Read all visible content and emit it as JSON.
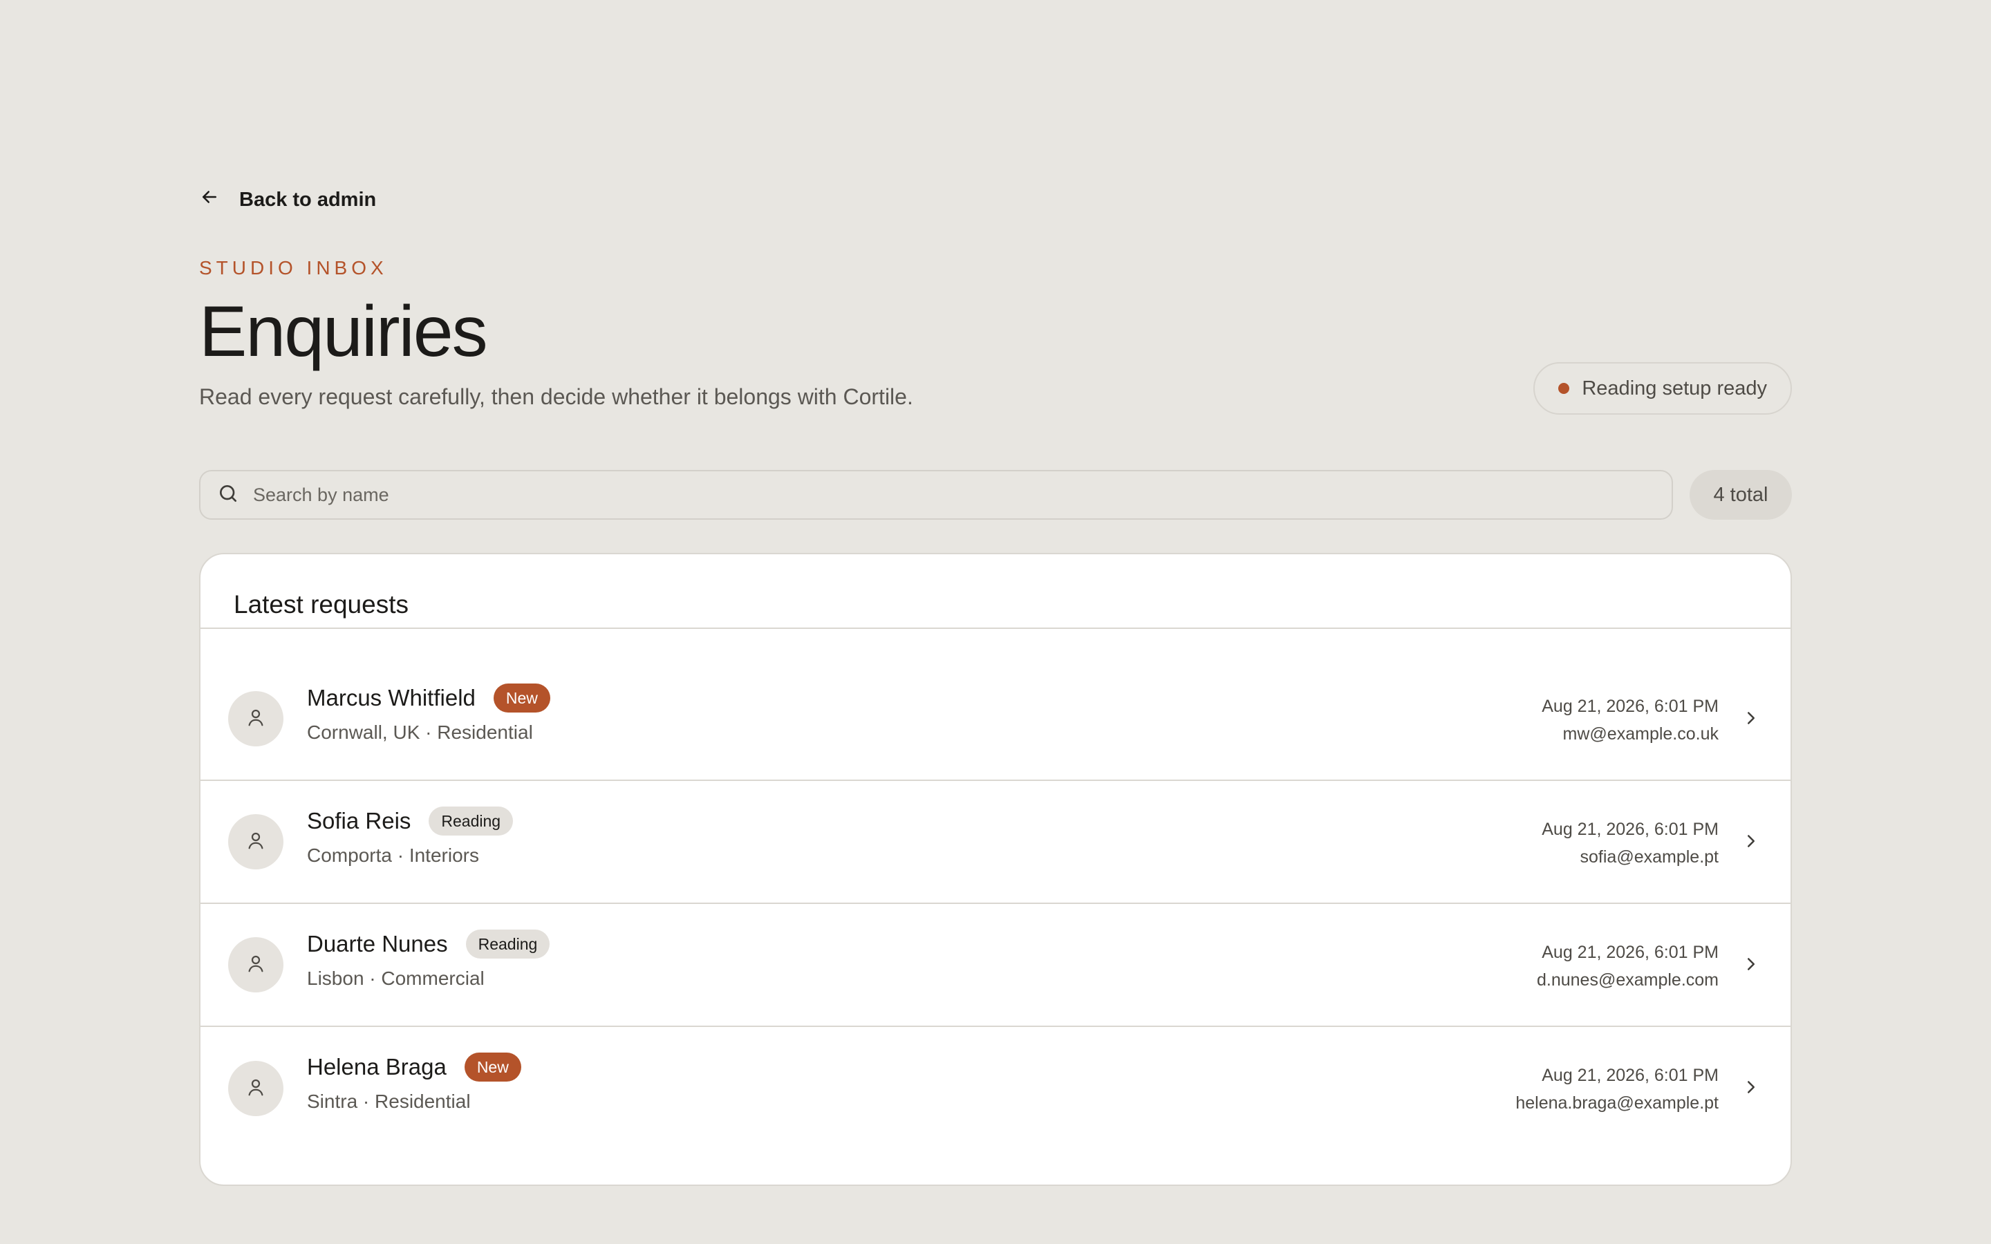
{
  "nav": {
    "back_label": "Back to admin"
  },
  "header": {
    "eyebrow": "STUDIO INBOX",
    "title": "Enquiries",
    "subtitle": "Read every request carefully, then decide whether it belongs with Cortile."
  },
  "status": {
    "label": "Reading setup ready",
    "dot_color": "#b4532a"
  },
  "search": {
    "placeholder": "Search by name",
    "value": ""
  },
  "total": {
    "label": "4 total"
  },
  "list": {
    "title": "Latest requests",
    "items": [
      {
        "name": "Marcus Whitfield",
        "badge": "New",
        "meta": "Cornwall, UK · Residential",
        "date": "Aug 21, 2026, 6:01 PM",
        "email": "mw@example.co.uk"
      },
      {
        "name": "Sofia Reis",
        "badge": "Reading",
        "meta": "Comporta · Interiors",
        "date": "Aug 21, 2026, 6:01 PM",
        "email": "sofia@example.pt"
      },
      {
        "name": "Duarte Nunes",
        "badge": "Reading",
        "meta": "Lisbon · Commercial",
        "date": "Aug 21, 2026, 6:01 PM",
        "email": "d.nunes@example.com"
      },
      {
        "name": "Helena Braga",
        "badge": "New",
        "meta": "Sintra · Residential",
        "date": "Aug 21, 2026, 6:01 PM",
        "email": "helena.braga@example.pt"
      }
    ]
  },
  "colors": {
    "accent": "#b4532a",
    "background": "#e8e6e1",
    "card": "#ffffff"
  },
  "icons": {
    "back": "arrow-left-icon",
    "search": "search-icon",
    "avatar": "user-icon",
    "row_action": "chevron-right-icon"
  }
}
